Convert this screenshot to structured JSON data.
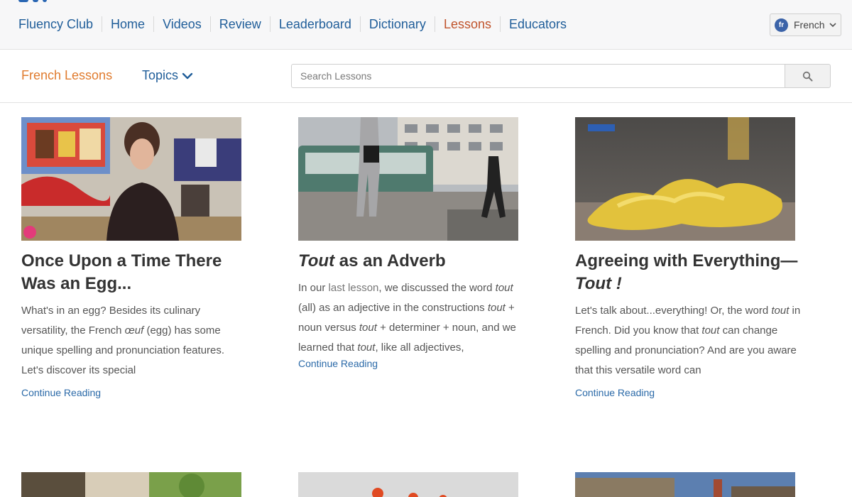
{
  "nav": {
    "items": [
      {
        "label": "Fluency Club",
        "active": false
      },
      {
        "label": "Home",
        "active": false
      },
      {
        "label": "Videos",
        "active": false
      },
      {
        "label": "Review",
        "active": false
      },
      {
        "label": "Leaderboard",
        "active": false
      },
      {
        "label": "Dictionary",
        "active": false
      },
      {
        "label": "Lessons",
        "active": true
      },
      {
        "label": "Educators",
        "active": false
      }
    ],
    "language": {
      "code": "fr",
      "label": "French"
    }
  },
  "subbar": {
    "title": "French Lessons",
    "topics_label": "Topics",
    "search_placeholder": "Search Lessons"
  },
  "cards": [
    {
      "title_pre": "",
      "title_em": "",
      "title_rest": "Once Upon a Time There Was an Egg...",
      "body": [
        {
          "t": "What's in an egg? Besides its culinary versatility, the French "
        },
        {
          "t": "œuf",
          "em": true
        },
        {
          "t": " (egg) has some unique spelling and pronunciation features. Let's discover its special"
        }
      ],
      "continue": "Continue Reading"
    },
    {
      "title_pre": "",
      "title_em": "Tout",
      "title_rest": " as an Adverb",
      "body": [
        {
          "t": "In our "
        },
        {
          "t": "last lesson",
          "link": true
        },
        {
          "t": ", we discussed the word "
        },
        {
          "t": "tout",
          "em": true
        },
        {
          "t": " (all) as an adjective in the constructions "
        },
        {
          "t": "tout",
          "em": true
        },
        {
          "t": " + noun versus "
        },
        {
          "t": "tout",
          "em": true
        },
        {
          "t": " + determiner + noun, and we learned that "
        },
        {
          "t": "tout",
          "em": true
        },
        {
          "t": ", like all adjectives,"
        }
      ],
      "continue": "Continue Reading"
    },
    {
      "title_pre": "Agreeing with Everything—",
      "title_em": "Tout !",
      "title_rest": "",
      "body": [
        {
          "t": "Let's talk about...everything! Or, the word "
        },
        {
          "t": "tout",
          "em": true
        },
        {
          "t": " in French. Did you know that "
        },
        {
          "t": "tout",
          "em": true
        },
        {
          "t": " can change spelling and pronunciation? And are you aware that this versatile word can"
        }
      ],
      "continue": "Continue Reading"
    }
  ],
  "colors": {
    "nav_link": "#1f5d99",
    "nav_active": "#c0532b",
    "section_title": "#e07b2e",
    "continue_link": "#2b6aa8"
  }
}
